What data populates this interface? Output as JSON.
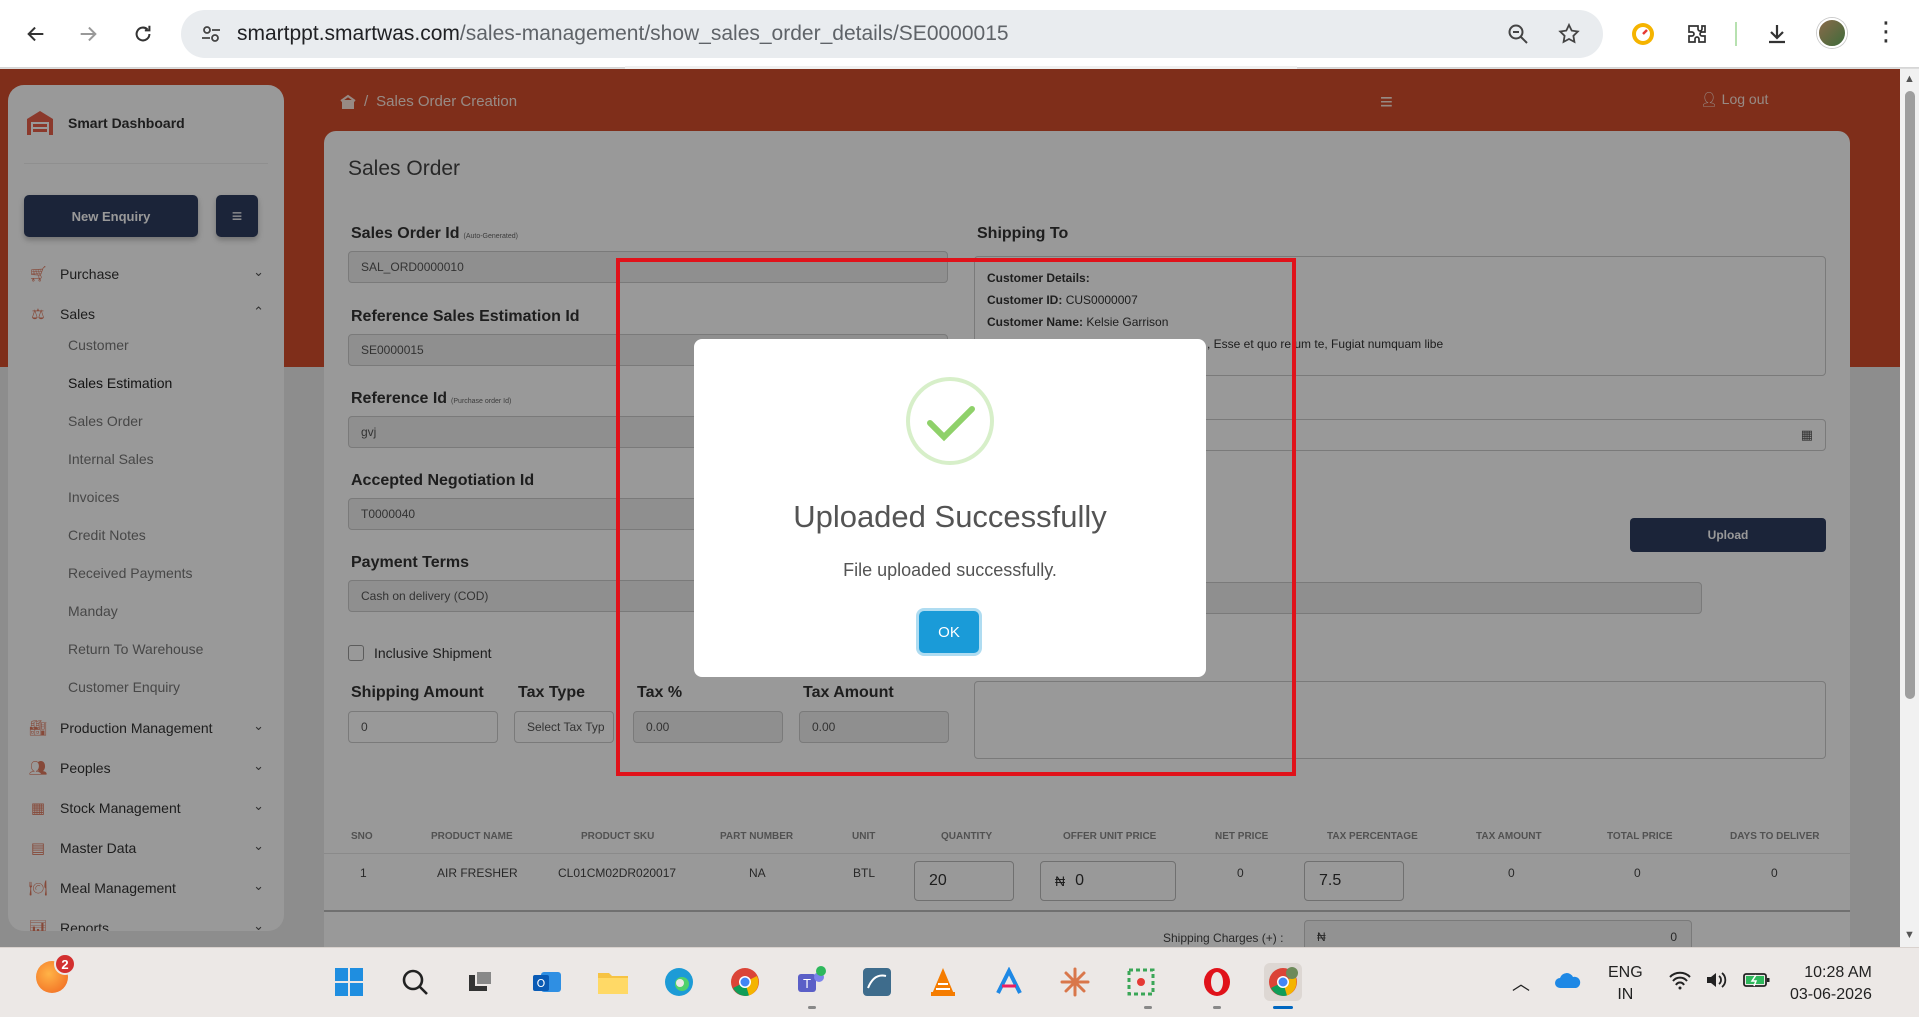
{
  "browser": {
    "url_host": "smartppt.smartwas.com",
    "url_path": "/sales-management/show_sales_order_details/SE0000015"
  },
  "sidebar": {
    "brand": "Smart Dashboard",
    "new_enquiry": "New Enquiry",
    "items": [
      {
        "label": "Purchase"
      },
      {
        "label": "Sales"
      },
      {
        "label": "Production Management"
      },
      {
        "label": "Peoples"
      },
      {
        "label": "Stock Management"
      },
      {
        "label": "Master Data"
      },
      {
        "label": "Meal Management"
      },
      {
        "label": "Reports"
      }
    ],
    "sales_sub": [
      "Customer",
      "Sales Estimation",
      "Sales Order",
      "Internal Sales",
      "Invoices",
      "Credit Notes",
      "Received Payments",
      "Manday",
      "Return To Warehouse",
      "Customer Enquiry"
    ]
  },
  "header": {
    "breadcrumb_sep": "/",
    "breadcrumb": "Sales Order Creation",
    "logout": "Log out"
  },
  "form": {
    "title": "Sales Order",
    "sales_order_id_label": "Sales Order Id",
    "sales_order_id_hint": "(Auto-Generated)",
    "sales_order_id": "SAL_ORD0000010",
    "ref_estimation_label": "Reference Sales Estimation Id",
    "ref_estimation": "SE0000015",
    "reference_id_label": "Reference Id",
    "reference_id_hint": "(Purchase order Id)",
    "reference_id": "gvj",
    "negotiation_label": "Accepted Negotiation Id",
    "negotiation": "T0000040",
    "payment_terms_label": "Payment Terms",
    "payment_terms": "Cash on delivery (COD)",
    "inclusive_shipment": "Inclusive Shipment",
    "shipping_amount_label": "Shipping Amount",
    "shipping_amount": "0",
    "tax_type_label": "Tax Type",
    "tax_type_placeholder": "Select Tax Typ",
    "tax_pct_label": "Tax %",
    "tax_pct": "0.00",
    "tax_amount_label": "Tax Amount",
    "tax_amount": "0.00",
    "shipping_to_label": "Shipping To",
    "customer_details_label": "Customer Details:",
    "customer_id_label": "Customer ID:",
    "customer_id": "CUS0000007",
    "customer_name_label": "Customer Name:",
    "customer_name": "Kelsie Garrison",
    "address_fragment": ", Esse et quo re  um te, Fugiat numquam libe",
    "upload": "Upload"
  },
  "table": {
    "headers": [
      "SNO",
      "PRODUCT NAME",
      "PRODUCT SKU",
      "PART NUMBER",
      "UNIT",
      "QUANTITY",
      "OFFER UNIT PRICE",
      "NET PRICE",
      "TAX PERCENTAGE",
      "TAX AMOUNT",
      "TOTAL PRICE",
      "DAYS TO DELIVER"
    ],
    "row": {
      "sno": "1",
      "product_name": "AIR FRESHER",
      "sku": "CL01CM02DR020017",
      "part": "NA",
      "unit": "BTL",
      "quantity": "20",
      "currency": "₦",
      "offer_price": "0",
      "net_price": "0",
      "tax_pct": "7.5",
      "tax_amount": "0",
      "total_price": "0",
      "days": "0"
    },
    "shipping_charges_label": "Shipping Charges (+) :",
    "shipping_charges_currency": "₦",
    "shipping_charges": "0"
  },
  "modal": {
    "title": "Uploaded Successfully",
    "text": "File uploaded successfully.",
    "ok": "OK"
  },
  "taskbar": {
    "notification_count": "2",
    "lang_1": "ENG",
    "lang_2": "IN",
    "time": "10:28 AM",
    "date": "03-06-2026"
  },
  "colors": {
    "banner": "#d44d2c",
    "primary": "#2e3c5f",
    "ok": "#1a9bd8",
    "highlight": "#e0121a",
    "success": "#8fd16a"
  }
}
